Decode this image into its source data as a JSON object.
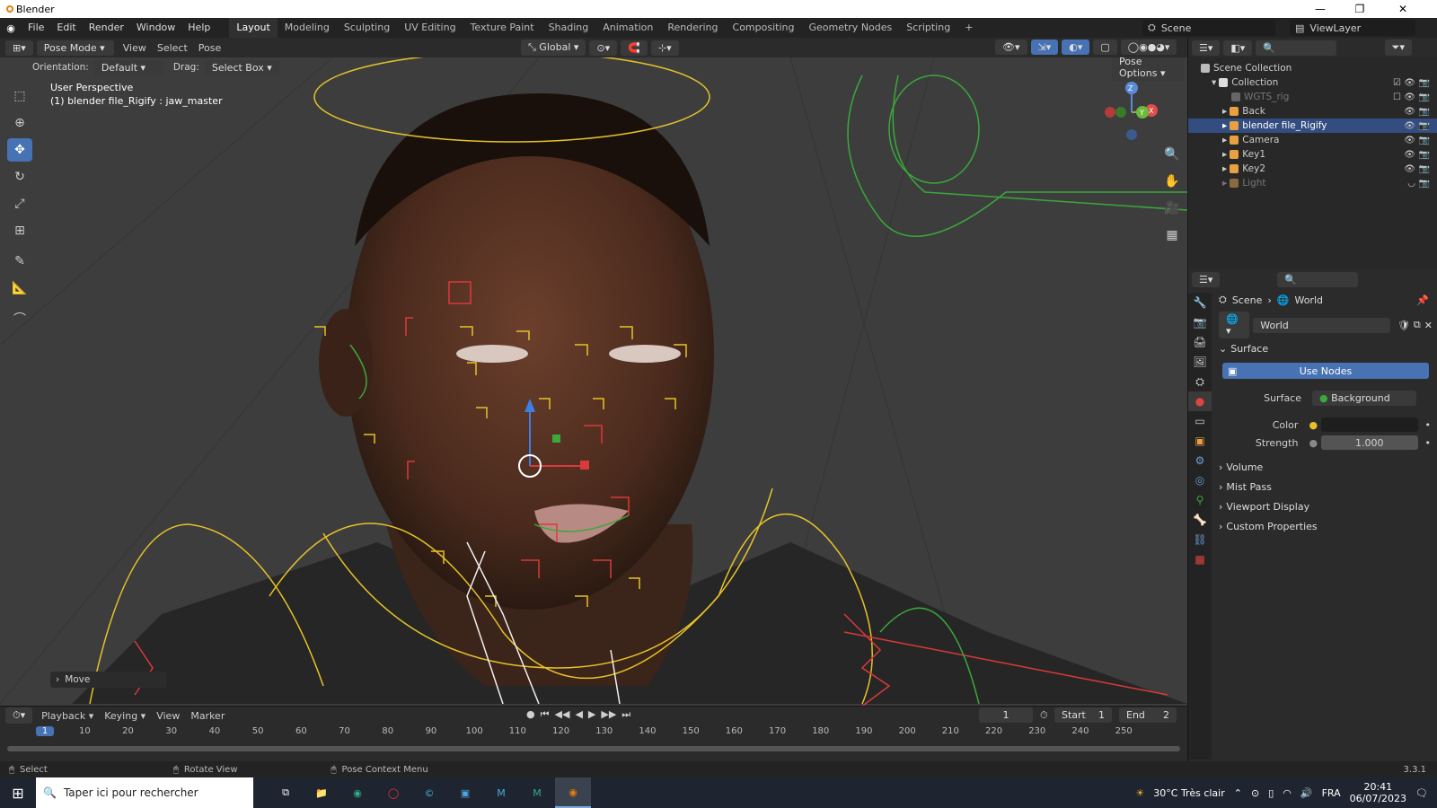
{
  "window": {
    "title": "Blender"
  },
  "menu": [
    "File",
    "Edit",
    "Render",
    "Window",
    "Help"
  ],
  "tabs": [
    "Layout",
    "Modeling",
    "Sculpting",
    "UV Editing",
    "Texture Paint",
    "Shading",
    "Animation",
    "Rendering",
    "Compositing",
    "Geometry Nodes",
    "Scripting",
    "+"
  ],
  "active_tab": "Layout",
  "scene": {
    "name": "Scene",
    "view_layer": "ViewLayer"
  },
  "viewport_header": {
    "mode": "Pose Mode",
    "menus": [
      "View",
      "Select",
      "Pose"
    ],
    "orientation_label": "Orientation:",
    "orientation_value": "Default",
    "drag_label": "Drag:",
    "drag_value": "Select Box",
    "transform": "Global",
    "pose_options": "Pose Options"
  },
  "viewport": {
    "perspective": "User Perspective",
    "object_info": "(1) blender file_Rigify : jaw_master",
    "operator_panel": "Move",
    "gizmo": {
      "x": "X",
      "y": "Y",
      "z": "Z"
    }
  },
  "outliner": {
    "rows": [
      {
        "name": "Scene Collection",
        "level": 0,
        "state": "normal"
      },
      {
        "name": "Collection",
        "level": 1,
        "state": "normal"
      },
      {
        "name": "WGTS_rig",
        "level": 2,
        "state": "dim"
      },
      {
        "name": "Back",
        "level": 2,
        "state": "normal"
      },
      {
        "name": "blender file_Rigify",
        "level": 2,
        "state": "selected"
      },
      {
        "name": "Camera",
        "level": 2,
        "state": "normal"
      },
      {
        "name": "Key1",
        "level": 2,
        "state": "normal"
      },
      {
        "name": "Key2",
        "level": 2,
        "state": "normal"
      },
      {
        "name": "Light",
        "level": 2,
        "state": "dim"
      }
    ]
  },
  "properties": {
    "breadcrumb": [
      "Scene",
      "World"
    ],
    "world_name": "World",
    "surface_panel": "Surface",
    "use_nodes": "Use Nodes",
    "surface_label": "Surface",
    "surface_value": "Background",
    "color_label": "Color",
    "strength_label": "Strength",
    "strength_value": "1.000",
    "collapsed_panels": [
      "Volume",
      "Mist Pass",
      "Viewport Display",
      "Custom Properties"
    ]
  },
  "timeline": {
    "menus": [
      "Playback",
      "Keying",
      "View",
      "Marker"
    ],
    "current_frame": "1",
    "start_label": "Start",
    "start_value": "1",
    "end_label": "End",
    "end_value": "2",
    "ruler": [
      "1",
      "10",
      "20",
      "30",
      "40",
      "50",
      "60",
      "70",
      "80",
      "90",
      "100",
      "110",
      "120",
      "130",
      "140",
      "150",
      "160",
      "170",
      "180",
      "190",
      "200",
      "210",
      "220",
      "230",
      "240",
      "250"
    ]
  },
  "statusbar": {
    "select": "Select",
    "rotate": "Rotate View",
    "context": "Pose Context Menu",
    "version": "3.3.1"
  },
  "taskbar": {
    "search": "Taper ici pour rechercher",
    "weather": "30°C  Très clair",
    "lang": "FRA",
    "time": "20:41",
    "date": "06/07/2023"
  }
}
